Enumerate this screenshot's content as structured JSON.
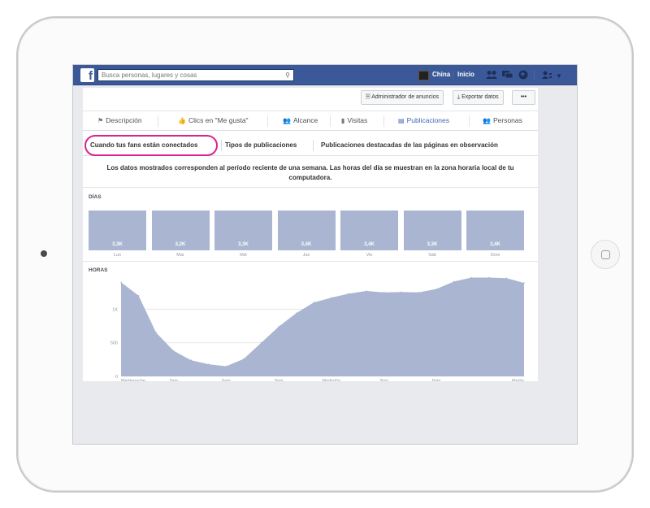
{
  "topbar": {
    "logo": "f",
    "search_placeholder": "Busca personas, lugares y cosas",
    "user_name": "China",
    "home_label": "Inicio"
  },
  "actions": {
    "ads_manager": "Administrador de anuncios",
    "export": "Exportar datos",
    "more": "•••"
  },
  "main_tabs": [
    {
      "label": "Descripción",
      "icon": "flag-icon",
      "glyph": "⚑"
    },
    {
      "label": "Clics en \"Me gusta\"",
      "icon": "thumbs-up-icon",
      "glyph": "👍"
    },
    {
      "label": "Alcance",
      "icon": "people-icon",
      "glyph": "👥"
    },
    {
      "label": "Visitas",
      "icon": "bar-chart-icon",
      "glyph": "▮"
    },
    {
      "label": "Publicaciones",
      "icon": "posts-icon",
      "glyph": "▤"
    },
    {
      "label": "Personas",
      "icon": "group-icon",
      "glyph": "👥"
    }
  ],
  "sub_tabs": [
    "Cuando tus fans están conectados",
    "Tipos de publicaciones",
    "Publicaciones destacadas de las páginas en observación"
  ],
  "info_text": "Los datos mostrados corresponden al período reciente de una semana. Las horas del día se muestran en la zona horaria local de tu computadora.",
  "days_label": "DÍAS",
  "hours_label": "HORAS",
  "colors": {
    "accent": "#3b5998",
    "bars": "#aab6d1",
    "highlight": "#d9248f"
  },
  "chart_data": [
    {
      "type": "bar",
      "categories": [
        "Lun",
        "Mar",
        "Mié",
        "Jue",
        "Vie",
        "Sáb",
        "Dom"
      ],
      "value_labels": [
        "3,3K",
        "3,2K",
        "3,3K",
        "3,4K",
        "3,4K",
        "3,3K",
        "3,4K"
      ],
      "values": [
        3300,
        3200,
        3300,
        3400,
        3400,
        3300,
        3400
      ],
      "title": "DÍAS"
    },
    {
      "type": "area",
      "title": "HORAS",
      "x_tick_labels": [
        "Medianoche",
        "3am",
        "6am",
        "9am",
        "Mediodía",
        "3pm",
        "6pm",
        "Media"
      ],
      "y_tick_labels": [
        "0",
        "500",
        "1K"
      ],
      "ylim": [
        0,
        1500
      ],
      "x": [
        0,
        1,
        2,
        3,
        4,
        5,
        6,
        7,
        8,
        9,
        10,
        11,
        12,
        13,
        14,
        15,
        16,
        17,
        18,
        19,
        20,
        21,
        22,
        23
      ],
      "values": [
        1400,
        1200,
        650,
        380,
        240,
        180,
        150,
        260,
        500,
        740,
        940,
        1100,
        1170,
        1230,
        1270,
        1250,
        1255,
        1250,
        1300,
        1410,
        1470,
        1470,
        1460,
        1390
      ]
    }
  ]
}
